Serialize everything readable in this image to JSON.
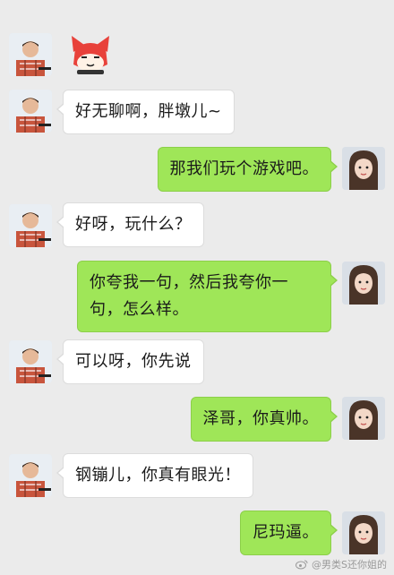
{
  "messages": [
    {
      "side": "in",
      "type": "sticker",
      "sticker": "red-fox-face-sticker"
    },
    {
      "side": "in",
      "text": "好无聊啊，胖墩儿~"
    },
    {
      "side": "out",
      "text": "那我们玩个游戏吧。"
    },
    {
      "side": "in",
      "text": "好呀，玩什么？"
    },
    {
      "side": "out",
      "text": "你夸我一句，然后我夸你一句，怎么样。"
    },
    {
      "side": "in",
      "text": "可以呀，你先说"
    },
    {
      "side": "out",
      "text": "泽哥，你真帅。"
    },
    {
      "side": "in",
      "text": "钢镚儿，你真有眼光！"
    },
    {
      "side": "out",
      "text": "尼玛逼。"
    }
  ],
  "watermark": {
    "text": "@男类S还你姐的",
    "icon": "weibo-icon"
  },
  "colors": {
    "background": "#ebebeb",
    "outgoing_bubble": "#9fe658",
    "incoming_bubble": "#ffffff",
    "sticker_red": "#e8413a"
  },
  "icons": {
    "male_avatar": "male-avatar-icon",
    "female_avatar": "female-avatar-icon"
  }
}
